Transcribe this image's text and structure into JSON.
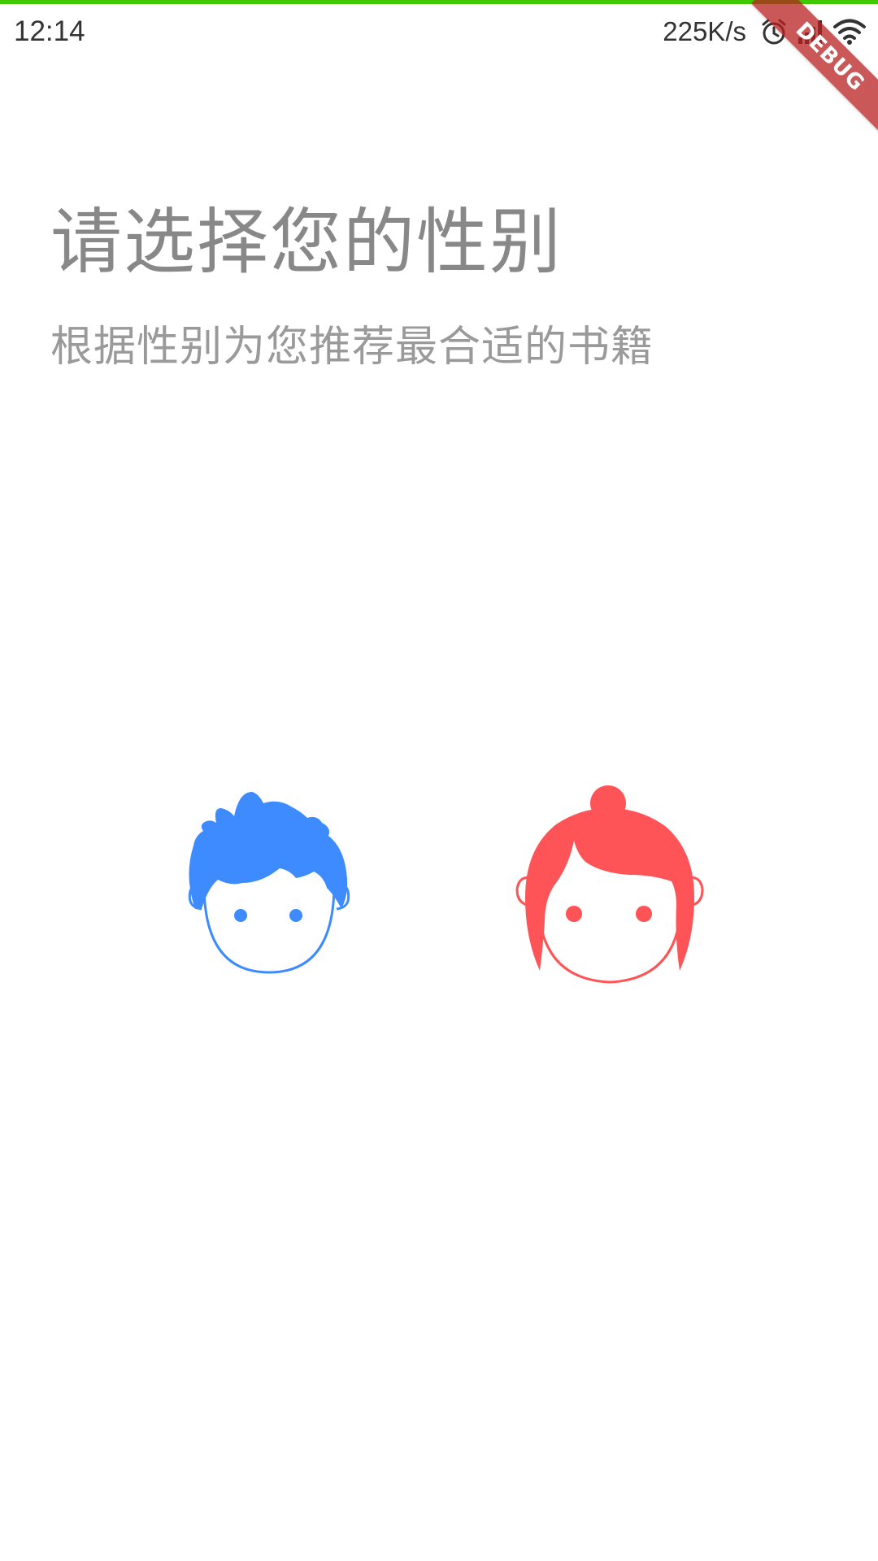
{
  "status_bar": {
    "time": "12:14",
    "net_speed": "225K/s",
    "icons": [
      "alarm-icon",
      "signal-icon",
      "wifi-icon"
    ]
  },
  "debug_banner": {
    "label": "DEBUG"
  },
  "header": {
    "title": "请选择您的性别",
    "subtitle": "根据性别为您推荐最合适的书籍"
  },
  "gender_options": {
    "male": {
      "icon": "boy-avatar-icon",
      "color": "#3d8bff"
    },
    "female": {
      "icon": "girl-avatar-icon",
      "color": "#ff5457"
    }
  },
  "colors": {
    "accent_bar": "#40c800",
    "title_text": "#888888",
    "subtitle_text": "#9a9a9a"
  }
}
